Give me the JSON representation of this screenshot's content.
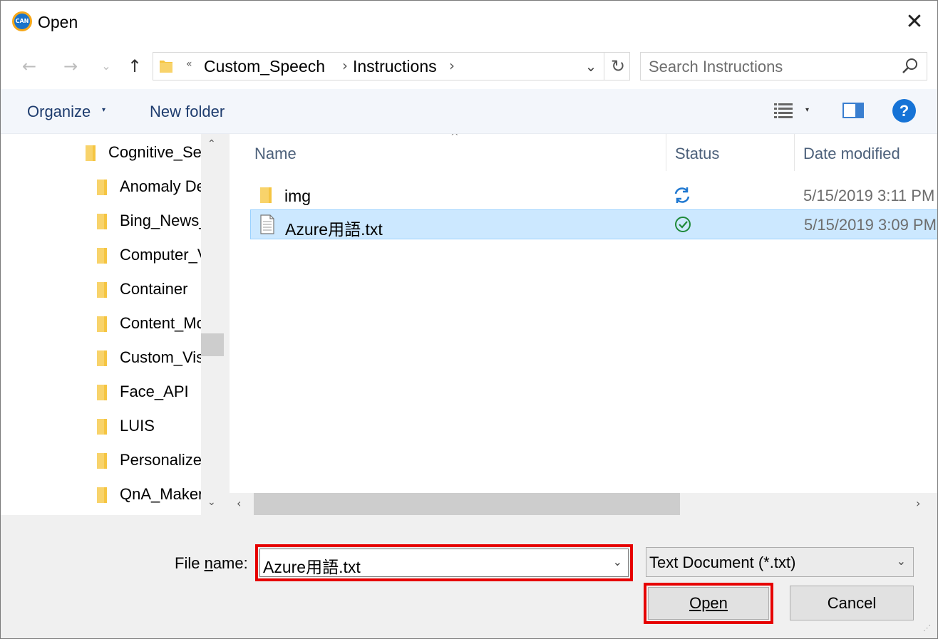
{
  "window": {
    "title": "Open",
    "app_icon_text": "CAN",
    "close_glyph": "✕"
  },
  "nav": {
    "back_glyph": "←",
    "forward_glyph": "→",
    "recent_glyph": "⌄",
    "up_glyph": "↑",
    "breadcrumb_overflow": "«",
    "breadcrumb": [
      "Custom_Speech",
      "Instructions"
    ],
    "chevron_glyph": "›",
    "dropdown_glyph": "⌄",
    "refresh_glyph": "↻"
  },
  "search": {
    "placeholder": "Search Instructions"
  },
  "commands": {
    "organize_label": "Organize",
    "organize_caret": "▾",
    "new_folder_label": "New folder",
    "view_caret": "▾",
    "help_glyph": "?"
  },
  "tree": {
    "items": [
      {
        "label": "Cognitive_Services",
        "indent": 0
      },
      {
        "label": "Anomaly Detector",
        "indent": 1
      },
      {
        "label": "Bing_News_Search",
        "indent": 1
      },
      {
        "label": "Computer_Vision",
        "indent": 1
      },
      {
        "label": "Container",
        "indent": 1
      },
      {
        "label": "Content_Moderator",
        "indent": 1
      },
      {
        "label": "Custom_Vision",
        "indent": 1
      },
      {
        "label": "Face_API",
        "indent": 1
      },
      {
        "label": "LUIS",
        "indent": 1
      },
      {
        "label": "Personalizer",
        "indent": 1
      },
      {
        "label": "QnA_Maker",
        "indent": 1
      }
    ],
    "scroll_up_glyph": "⌃",
    "scroll_down_glyph": "⌄"
  },
  "filelist": {
    "columns": {
      "name": "Name",
      "status": "Status",
      "date": "Date modified"
    },
    "sort_glyph": "^",
    "rows": [
      {
        "name": "img",
        "type": "folder",
        "status": "sync",
        "date": "5/15/2019 3:11 PM",
        "selected": false
      },
      {
        "name": "Azure用語.txt",
        "type": "text-file",
        "status": "synced",
        "date": "5/15/2019 3:09 PM",
        "selected": true
      }
    ],
    "scroll_left_glyph": "‹",
    "scroll_right_glyph": "›"
  },
  "bottom": {
    "file_name_label_pre": "File ",
    "file_name_label_u": "n",
    "file_name_label_post": "ame:",
    "file_name_value": "Azure用語.txt",
    "file_type_value": "Text Document (*.txt)",
    "caret_glyph": "⌄",
    "open_label": "Open",
    "cancel_label": "Cancel",
    "grip_glyph": "⋰"
  },
  "colors": {
    "highlight": "#e60000",
    "selection": "#cce8ff",
    "accent": "#1673d6",
    "folder": "#f5c542"
  }
}
